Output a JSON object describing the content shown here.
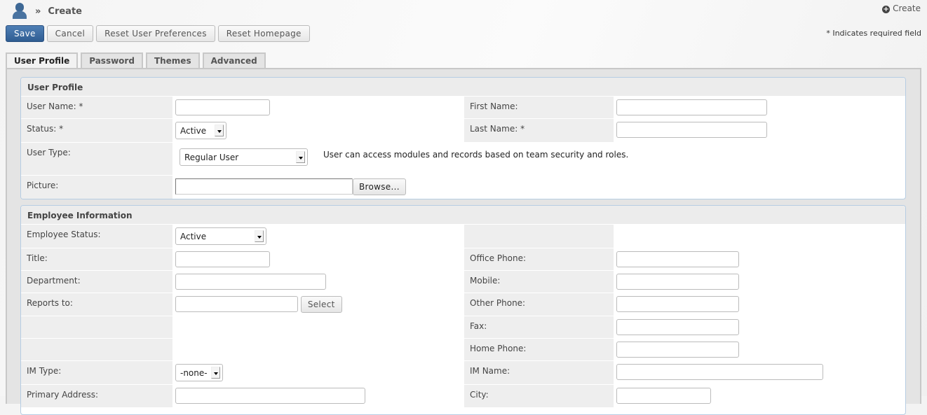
{
  "header": {
    "breadcrumb_sep": "»",
    "title": "Create",
    "create_link": "Create"
  },
  "toolbar": {
    "save": "Save",
    "cancel": "Cancel",
    "reset_prefs": "Reset User Preferences",
    "reset_home": "Reset Homepage",
    "required_note": "* Indicates required field"
  },
  "tabs": [
    {
      "label": "User Profile"
    },
    {
      "label": "Password"
    },
    {
      "label": "Themes"
    },
    {
      "label": "Advanced"
    }
  ],
  "user_profile": {
    "heading": "User Profile",
    "user_name": "User Name: *",
    "first_name": "First Name:",
    "status": "Status: *",
    "status_value": "Active",
    "last_name": "Last Name: *",
    "user_type": "User Type:",
    "user_type_value": "Regular User",
    "user_type_desc": "User can access modules and records based on team security and roles.",
    "picture": "Picture:",
    "browse": "Browse..."
  },
  "employee": {
    "heading": "Employee Information",
    "employee_status": "Employee Status:",
    "employee_status_value": "Active",
    "title": "Title:",
    "office_phone": "Office Phone:",
    "department": "Department:",
    "mobile": "Mobile:",
    "reports_to": "Reports to:",
    "select": "Select",
    "other_phone": "Other Phone:",
    "fax": "Fax:",
    "home_phone": "Home Phone:",
    "im_type": "IM Type:",
    "im_type_value": "-none-",
    "im_name": "IM Name:",
    "primary_address": "Primary Address:",
    "city": "City:"
  }
}
